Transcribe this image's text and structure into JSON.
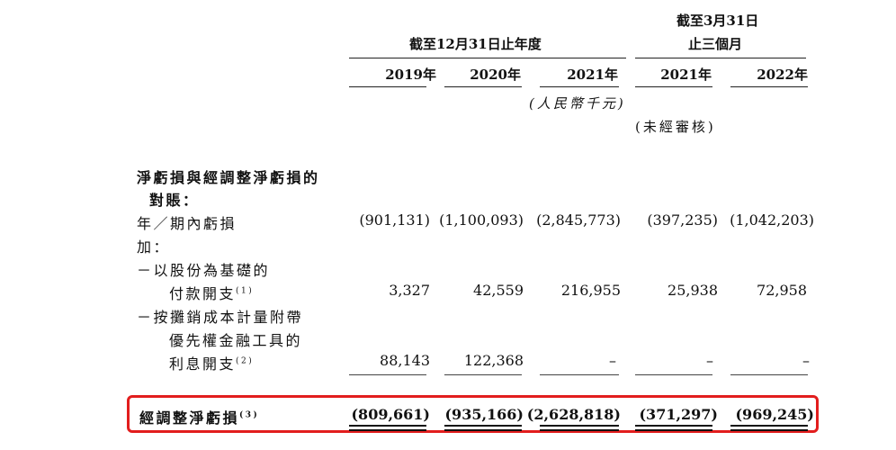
{
  "header": {
    "group_year_end": "截至12月31日止年度",
    "group_mar_line1": "截至3月31日",
    "group_mar_line2": "止三個月",
    "years": [
      "2019年",
      "2020年",
      "2021年",
      "2021年",
      "2022年"
    ],
    "currency_note": "(人民幣千元)",
    "unaudited_note": "(未經審核)"
  },
  "rows": {
    "reconciliation_title_line1": "淨虧損與經調整淨虧損的",
    "reconciliation_title_line2": "對賬：",
    "loss_label": "年／期內虧損",
    "loss_values": [
      "(901,131)",
      "(1,100,093)",
      "(2,845,773)",
      "(397,235)",
      "(1,042,203)"
    ],
    "add_label": "加：",
    "sbc_line1": "－以股份為基礎的",
    "sbc_line2": "付款開支",
    "sbc_note": "(1)",
    "sbc_values": [
      "3,327",
      "42,559",
      "216,955",
      "25,938",
      "72,958"
    ],
    "int_line1": "－按攤銷成本計量附帶",
    "int_line2": "優先權金融工具的",
    "int_line3": "利息開支",
    "int_note": "(2)",
    "int_values": [
      "88,143",
      "122,368",
      "–",
      "–",
      "–"
    ],
    "adj_label": "經調整淨虧損",
    "adj_note": "(3)",
    "adj_values": [
      "(809,661)",
      "(935,166)",
      "(2,628,818)",
      "(371,297)",
      "(969,245)"
    ]
  },
  "colors": {
    "highlight_border": "#e21d1d"
  }
}
